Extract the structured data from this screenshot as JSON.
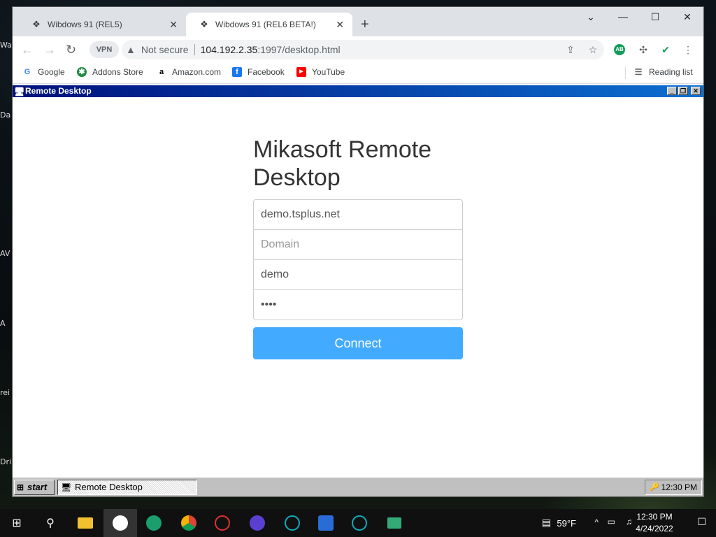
{
  "browser": {
    "tabs": [
      {
        "title": "Wibdows 91 (REL5)"
      },
      {
        "title": "Wibdows 91 (REL6 BETA!)"
      }
    ],
    "new_tab": "+",
    "window_controls": {
      "minimize": "⌄",
      "restore": "—",
      "maximize": "☐",
      "close": "✕"
    },
    "toolbar": {
      "vpn_label": "VPN",
      "security_text": "Not secure",
      "url_host": "104.192.2.35",
      "url_path": ":1997/desktop.html",
      "extension_badge": "AB"
    },
    "bookmarks": [
      {
        "label": "Google",
        "icon": "google-icon",
        "color": "#4285f4",
        "glyph": "G"
      },
      {
        "label": "Addons Store",
        "icon": "addons-store-icon",
        "color": "#1b8a3f",
        "glyph": "✱"
      },
      {
        "label": "Amazon.com",
        "icon": "amazon-icon",
        "color": "#000000",
        "glyph": "a"
      },
      {
        "label": "Facebook",
        "icon": "facebook-icon",
        "color": "#1877f2",
        "glyph": "f"
      },
      {
        "label": "YouTube",
        "icon": "youtube-icon",
        "color": "#ff0000",
        "glyph": "▶"
      }
    ],
    "reading_list": "Reading list"
  },
  "remote_window": {
    "title": "Remote Desktop"
  },
  "login": {
    "heading": "Mikasoft Remote Desktop",
    "server_value": "demo.tsplus.net",
    "domain_placeholder": "Domain",
    "username_value": "demo",
    "password_value": "demo",
    "connect_label": "Connect",
    "accent_color": "#42aaff"
  },
  "w98_taskbar": {
    "start_label": "start",
    "task_item": "Remote Desktop",
    "clock": "12:30 PM"
  },
  "desktop_icons": [
    "Wa",
    "Da",
    "AV",
    "A",
    "rei",
    "Dri"
  ],
  "win10_taskbar": {
    "weather": "59°F",
    "time": "12:30 PM",
    "date": "4/24/2022"
  }
}
